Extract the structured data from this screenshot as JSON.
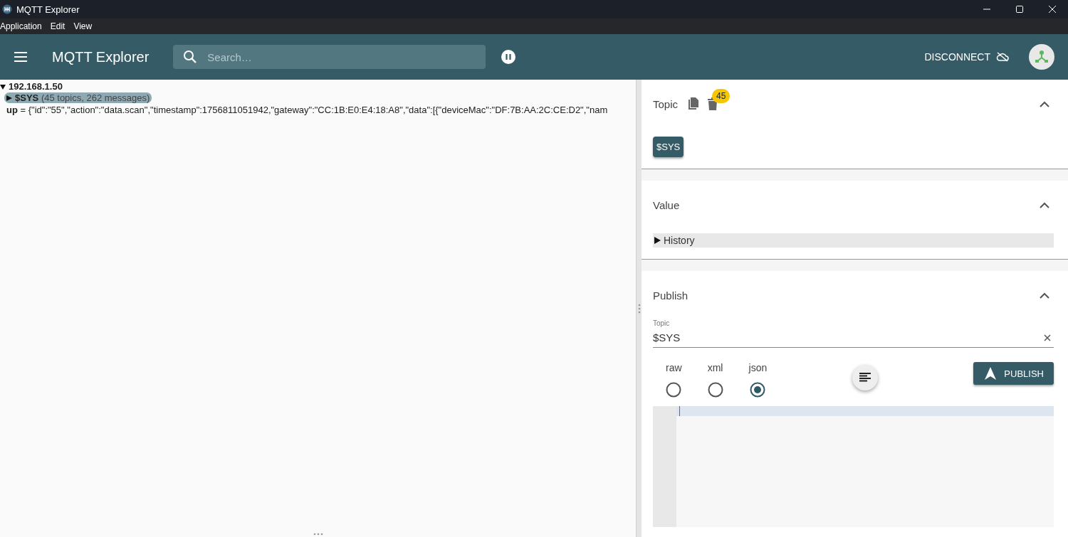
{
  "window": {
    "title": "MQTT Explorer"
  },
  "menu": [
    "Application",
    "Edit",
    "View"
  ],
  "app_bar": {
    "title": "MQTT Explorer",
    "search": {
      "placeholder": "Search…"
    },
    "disconnect": "DISCONNECT"
  },
  "tree": {
    "label": "192.168.1.50",
    "expanded": true,
    "children": [
      {
        "kind": "topic",
        "label": "$SYS",
        "summary": "(45 topics, 262 messages)",
        "expanded": false,
        "selected": true
      },
      {
        "kind": "value",
        "label": "up",
        "value": "= {\"id\":\"55\",\"action\":\"data.scan\",\"timestamp\":1756811051942,\"gateway\":\"CC:1B:E0:E4:18:A8\",\"data\":[{\"deviceMac\":\"DF:7B:AA:2C:CE:D2\",\"nam",
        "selected": false
      }
    ]
  },
  "topic_section": {
    "title": "Topic",
    "expanded": true,
    "badge": "45",
    "chip": "$SYS"
  },
  "value_section": {
    "title": "Value",
    "expanded": true,
    "history": "History"
  },
  "publish_section": {
    "title": "Publish",
    "expanded": true,
    "topic_label": "Topic",
    "topic_value": "$SYS",
    "formats": [
      {
        "label": "raw",
        "selected": false
      },
      {
        "label": "xml",
        "selected": false
      },
      {
        "label": "json",
        "selected": true
      }
    ],
    "button": "PUBLISH"
  }
}
